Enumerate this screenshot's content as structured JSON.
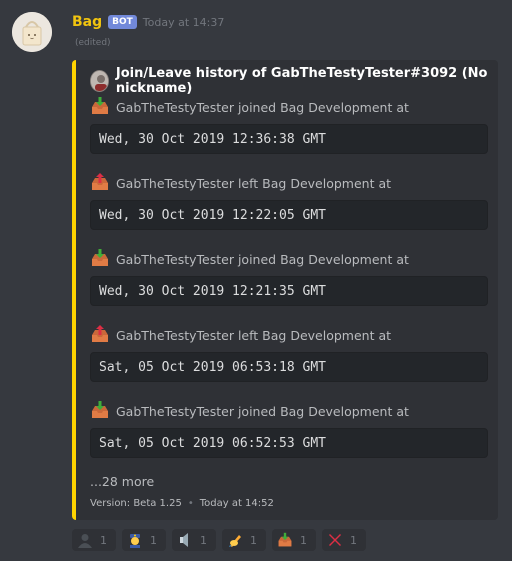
{
  "message": {
    "username": "Bag",
    "bot_tag": "BOT",
    "timestamp": "Today at 14:37",
    "edited": "(edited)"
  },
  "embed": {
    "accent_color": "#ffd300",
    "author": "Join/Leave history of GabTheTestyTester#3092 (No nickname)",
    "entries": [
      {
        "type": "join",
        "icon": "inbox-tray-icon",
        "text": "GabTheTestyTester joined Bag Development at",
        "time": "Wed, 30 Oct 2019 12:36:38 GMT"
      },
      {
        "type": "leave",
        "icon": "outbox-tray-icon",
        "text": "GabTheTestyTester left Bag Development at",
        "time": "Wed, 30 Oct 2019 12:22:05 GMT"
      },
      {
        "type": "join",
        "icon": "inbox-tray-icon",
        "text": "GabTheTestyTester joined Bag Development at",
        "time": "Wed, 30 Oct 2019 12:21:35 GMT"
      },
      {
        "type": "leave",
        "icon": "outbox-tray-icon",
        "text": "GabTheTestyTester left Bag Development at",
        "time": "Sat, 05 Oct 2019 06:53:18 GMT"
      },
      {
        "type": "join",
        "icon": "inbox-tray-icon",
        "text": "GabTheTestyTester joined Bag Development at",
        "time": "Sat, 05 Oct 2019 06:52:53 GMT"
      }
    ],
    "more": "...28 more",
    "footer_version": "Version: Beta 1.25",
    "footer_dot": "•",
    "footer_time": "Today at 14:52"
  },
  "reactions": [
    {
      "emoji": "bust-in-silhouette-icon",
      "count": "1"
    },
    {
      "emoji": "police-officer-icon",
      "count": "1"
    },
    {
      "emoji": "speaker-icon",
      "count": "1"
    },
    {
      "emoji": "writing-hand-icon",
      "count": "1"
    },
    {
      "emoji": "inbox-tray-icon",
      "count": "1"
    },
    {
      "emoji": "cross-mark-icon",
      "count": "1"
    }
  ]
}
